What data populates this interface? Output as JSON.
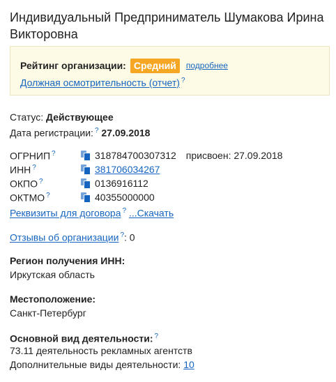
{
  "header": {
    "title": "Индивидуальный Предприниматель Шумакова Ирина Викторовна"
  },
  "rating": {
    "label": "Рейтинг организации:",
    "value": "Средний",
    "more_link": "подробнее",
    "due_diligence_link": "Должная осмотрительность (отчет)",
    "help_mark": "?"
  },
  "status": {
    "label": "Статус:",
    "value": "Действующее"
  },
  "registration": {
    "label": "Дата регистрации:",
    "help_mark": "?",
    "value": "27.09.2018"
  },
  "codes": [
    {
      "name": "ОГРНИП",
      "help": "?",
      "value": "318784700307312",
      "extra": "присвоен: 27.09.2018"
    },
    {
      "name": "ИНН",
      "help": "?",
      "value": "381706034267",
      "extra": ""
    },
    {
      "name": "ОКПО",
      "help": "?",
      "value": "0136916112",
      "extra": ""
    },
    {
      "name": "ОКТМО",
      "help": "?",
      "value": "40355000000",
      "extra": ""
    }
  ],
  "contract": {
    "requisites_link": "Реквизиты для договора",
    "help_mark": "?",
    "download_link": "...Скачать"
  },
  "reviews": {
    "link": "Отзывы об организации",
    "help_mark": "?",
    "count": ": 0"
  },
  "inn_region": {
    "title": "Регион получения ИНН:",
    "value": "Иркутская область"
  },
  "location": {
    "title": "Местоположение:",
    "value": "Санкт-Петербург"
  },
  "activity": {
    "title": "Основной вид деятельности:",
    "help_mark": "?",
    "main": "73.11 деятельность рекламных агентств",
    "extra_label": "Дополнительные виды деятельности:",
    "extra_count": "10"
  },
  "colors": {
    "link": "#1565c0",
    "badge": "#f5a623",
    "panel_bg": "#fdfae6"
  }
}
